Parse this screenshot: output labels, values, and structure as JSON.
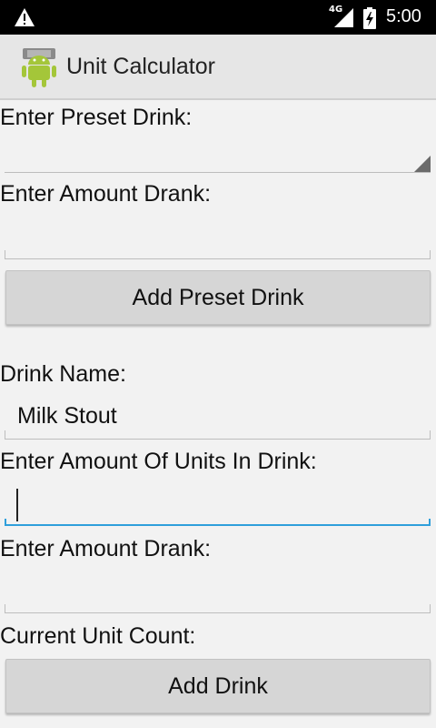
{
  "status_bar": {
    "network": "4G",
    "time": "5:00",
    "icons": [
      "warning-icon",
      "signal-icon",
      "battery-charging-icon"
    ]
  },
  "app_bar": {
    "title": "Unit Calculator",
    "logo": "android-logo-icon"
  },
  "preset_section": {
    "preset_label": "Enter Preset Drink:",
    "preset_selected": "",
    "amount_label": "Enter Amount Drank:",
    "amount_value": "",
    "add_button": "Add Preset Drink"
  },
  "custom_section": {
    "name_label": "Drink Name:",
    "name_value": "Milk Stout",
    "units_label": "Enter Amount Of Units In Drink:",
    "units_value": "",
    "amount_label": "Enter Amount Drank:",
    "amount_value": "",
    "count_label": "Current Unit Count:",
    "add_button": "Add Drink"
  },
  "colors": {
    "status_bar": "#000000",
    "app_bar": "#e6e6e6",
    "background": "#f2f2f2",
    "focus_accent": "#2f9fdb",
    "button": "#d6d6d6"
  }
}
